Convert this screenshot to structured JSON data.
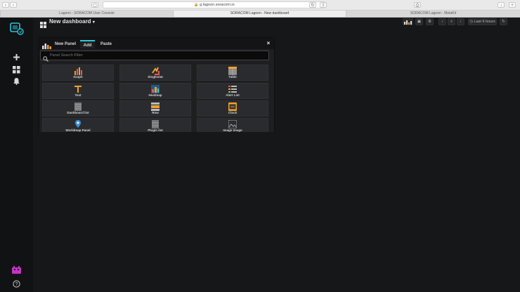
{
  "browser": {
    "url": "g.lagoon.soracom.io",
    "tabs": [
      {
        "title": "Lagoon - SORACOM User Console"
      },
      {
        "title": "SORACOM Lagoon - New dashboard"
      },
      {
        "title": "SORACOM Lagoon - MetaKit"
      }
    ]
  },
  "dashboard": {
    "title": "New dashboard",
    "time_range": "Last 6 hours"
  },
  "panel": {
    "title": "New Panel",
    "tabs": [
      "Add",
      "Paste"
    ],
    "search_placeholder": "Panel Search Filter",
    "items": [
      {
        "label": "Graph",
        "icon": "graph-icon"
      },
      {
        "label": "Singlestat",
        "icon": "singlestat-icon"
      },
      {
        "label": "Table",
        "icon": "table-icon"
      },
      {
        "label": "Text",
        "icon": "text-icon"
      },
      {
        "label": "Heatmap",
        "icon": "heatmap-icon"
      },
      {
        "label": "Alert List",
        "icon": "alert-list-icon"
      },
      {
        "label": "Dashboard list",
        "icon": "dashboard-list-icon"
      },
      {
        "label": "Row",
        "icon": "row-icon"
      },
      {
        "label": "Clock",
        "icon": "clock-icon"
      },
      {
        "label": "Worldmap Panel",
        "icon": "worldmap-icon"
      },
      {
        "label": "Plugin list",
        "icon": "plugin-list-icon"
      },
      {
        "label": "Image Image",
        "icon": "image-icon"
      }
    ]
  },
  "colors": {
    "accent": "#2dc7d8",
    "background": "#161719",
    "sidebar": "#111214",
    "panel": "#1f1f21",
    "card": "#2a2b2e"
  }
}
